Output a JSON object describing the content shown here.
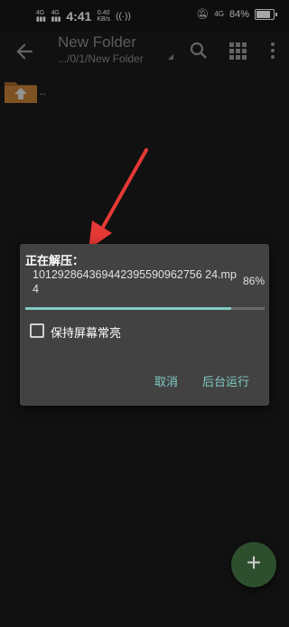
{
  "status_bar": {
    "network1": "4G",
    "network2": "4G",
    "time": "4:41",
    "speed_value": "0.40",
    "speed_unit": "KB/s",
    "battery_label": "84%",
    "extra_net": "4G"
  },
  "toolbar": {
    "title": "New Folder",
    "path": ".../0/1/New Folder"
  },
  "list": {
    "up_item_label": ".."
  },
  "dialog": {
    "title": "正在解压：",
    "filename": "101292864369442395590962756 24.mp4",
    "percent_label": "86%",
    "progress": 0.86,
    "keep_screen_on_label": "保持屏幕常亮",
    "keep_screen_on_checked": false,
    "cancel_label": "取消",
    "background_label": "后台运行"
  },
  "colors": {
    "accent": "#80cbc4",
    "dialog_bg": "#424242",
    "arrow": "#e53935"
  },
  "icons": [
    "back-arrow-icon",
    "search-icon",
    "grid-view-icon",
    "more-vert-icon",
    "folder-up-icon",
    "add-icon",
    "battery-icon"
  ]
}
